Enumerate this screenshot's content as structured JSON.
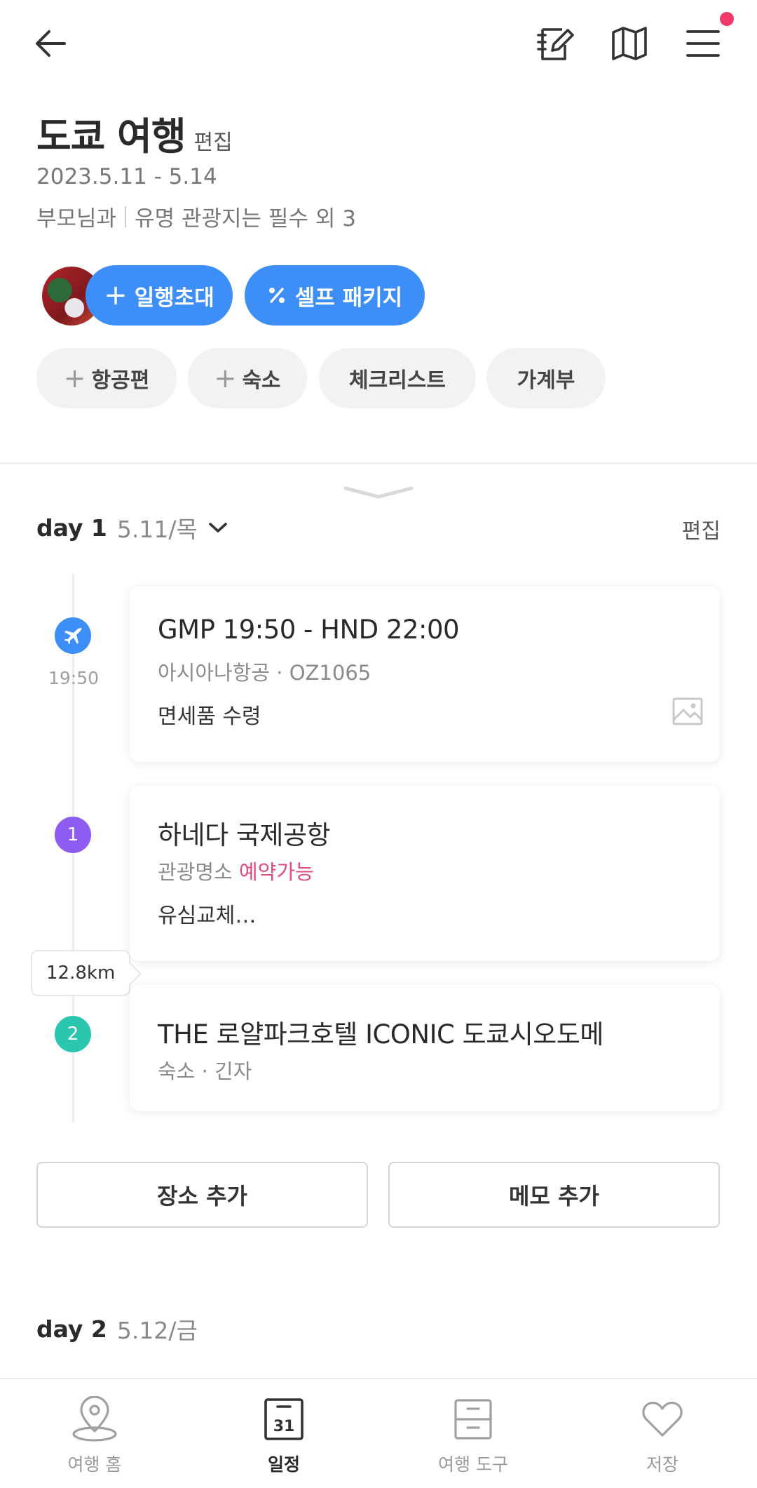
{
  "header": {
    "title": "도쿄 여행",
    "title_edit": "편집",
    "dates": "2023.5.11 - 5.14",
    "tags": [
      "부모님과",
      "유명 관광지는 필수 외 3"
    ]
  },
  "actions": {
    "invite_label": "일행초대",
    "package_label": "셀프 패키지"
  },
  "chips": [
    {
      "label": "항공편",
      "has_plus": true
    },
    {
      "label": "숙소",
      "has_plus": true
    },
    {
      "label": "체크리스트",
      "has_plus": false
    },
    {
      "label": "가계부",
      "has_plus": false
    }
  ],
  "day1": {
    "label": "day 1",
    "date": "5.11/목",
    "edit": "편집",
    "items": [
      {
        "kind": "flight",
        "title": "GMP 19:50 - HND 22:00",
        "sub": "아시아나항공 · OZ1065",
        "memo": "면세품 수령",
        "time": "19:50",
        "icon": "airplane-icon",
        "color": "#3d8ff7"
      },
      {
        "kind": "place",
        "number": "1",
        "title": "하네다 국제공항",
        "sub": "관광명소",
        "sub_accent": "예약가능",
        "memo": "유심교체…",
        "color": "#8e5cf0"
      },
      {
        "kind": "place",
        "number": "2",
        "title": "THE 로얄파크호텔 ICONIC 도쿄시오도메",
        "sub": "숙소 · 긴자",
        "color": "#2cc6b0"
      }
    ],
    "distance": "12.8km",
    "add_place": "장소 추가",
    "add_memo": "메모 추가"
  },
  "day2": {
    "label": "day 2",
    "date": "5.12/금"
  },
  "bottom_nav": [
    {
      "label": "여행 홈",
      "icon": "location-pin-icon",
      "active": false
    },
    {
      "label": "일정",
      "icon": "calendar-icon",
      "calendar_day": "31",
      "active": true
    },
    {
      "label": "여행 도구",
      "icon": "toolbox-icon",
      "active": false
    },
    {
      "label": "저장",
      "icon": "heart-icon",
      "active": false
    }
  ],
  "colors": {
    "accent_blue": "#3d8ff7",
    "notification": "#f23a6a",
    "reservable": "#e04c7a"
  }
}
